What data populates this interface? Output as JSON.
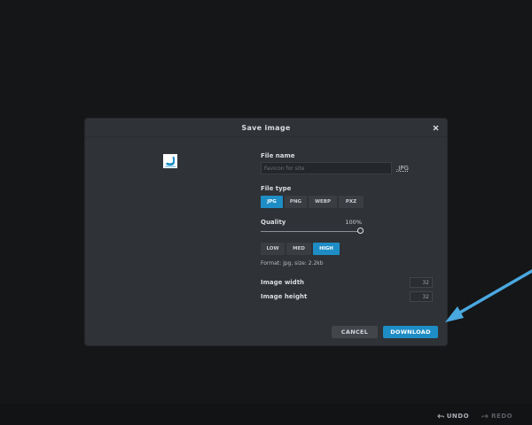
{
  "dialog": {
    "title": "Save image",
    "close_icon": "close-icon"
  },
  "file_name": {
    "label": "File name",
    "placeholder": "Favicon for site",
    "value": "",
    "extension": ".JPG"
  },
  "file_type": {
    "label": "File type",
    "options": [
      "JPG",
      "PNG",
      "WEBP",
      "PXZ"
    ],
    "selected": "JPG"
  },
  "quality": {
    "label": "Quality",
    "value_text": "100%",
    "value": 100,
    "presets": [
      "LOW",
      "MED",
      "HIGH"
    ],
    "selected_preset": "HIGH"
  },
  "format_info": "Format: jpg, size: 2.2kb",
  "image_width": {
    "label": "Image width",
    "value": "32"
  },
  "image_height": {
    "label": "Image height",
    "value": "32"
  },
  "buttons": {
    "cancel": "CANCEL",
    "download": "DOWNLOAD"
  },
  "history": {
    "undo": "UNDO",
    "redo": "REDO"
  },
  "colors": {
    "accent": "#1e8dc6",
    "arrow": "#4aa8e0",
    "dialog_bg": "#2f3236",
    "page_bg": "#151618"
  }
}
